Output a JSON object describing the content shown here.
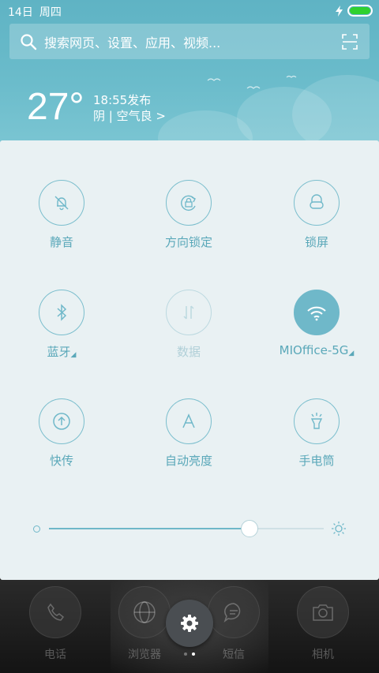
{
  "status_bar": {
    "date": "14日",
    "weekday": "周四"
  },
  "search": {
    "placeholder": "搜索网页、设置、应用、视频..."
  },
  "weather": {
    "temperature": "27°",
    "publish_time": "18:55发布",
    "condition": "阴 | 空气良 >"
  },
  "toggles": [
    {
      "label": "静音",
      "icon": "bell-off-icon",
      "state": "off"
    },
    {
      "label": "方向锁定",
      "icon": "rotation-lock-icon",
      "state": "off"
    },
    {
      "label": "锁屏",
      "icon": "lock-icon",
      "state": "off"
    },
    {
      "label": "蓝牙",
      "icon": "bluetooth-icon",
      "state": "off"
    },
    {
      "label": "数据",
      "icon": "data-arrows-icon",
      "state": "disabled"
    },
    {
      "label": "MIOffice-5G",
      "icon": "wifi-icon",
      "state": "on"
    },
    {
      "label": "快传",
      "icon": "upload-icon",
      "state": "off"
    },
    {
      "label": "自动亮度",
      "icon": "letter-a-icon",
      "state": "off"
    },
    {
      "label": "手电筒",
      "icon": "flashlight-icon",
      "state": "off"
    }
  ],
  "brightness": {
    "level": 0.73
  },
  "dock": [
    {
      "label": "电话",
      "icon": "phone-icon"
    },
    {
      "label": "浏览器",
      "icon": "globe-icon"
    },
    {
      "label": "短信",
      "icon": "message-icon"
    },
    {
      "label": "相机",
      "icon": "camera-icon"
    }
  ],
  "colors": {
    "accent": "#6fb8c9",
    "panel_bg": "#e9f1f3",
    "header_bg": "#66b8c8",
    "battery": "#2fd12f"
  }
}
